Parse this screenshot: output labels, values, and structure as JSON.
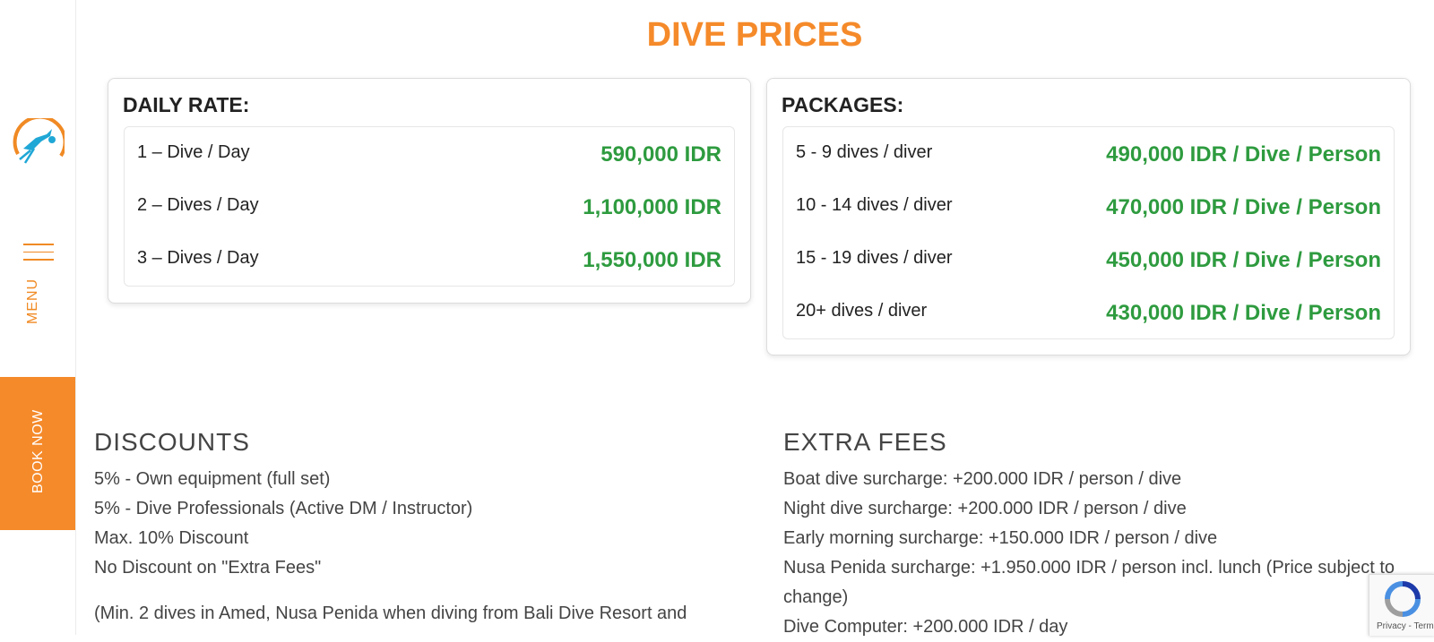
{
  "sidebar": {
    "menu_label": "MENU",
    "book_now_label": "BOOK NOW"
  },
  "page_title": "DIVE PRICES",
  "daily_rate": {
    "heading": "DAILY RATE:",
    "rows": [
      {
        "label": "1 – Dive / Day",
        "price": "590,000 IDR"
      },
      {
        "label": "2 – Dives / Day",
        "price": "1,100,000 IDR"
      },
      {
        "label": "3 – Dives / Day",
        "price": "1,550,000 IDR"
      }
    ]
  },
  "packages": {
    "heading": "PACKAGES:",
    "rows": [
      {
        "label": "5 - 9 dives / diver",
        "price": "490,000 IDR / Dive / Person"
      },
      {
        "label": "10 - 14 dives / diver",
        "price": "470,000 IDR / Dive / Person"
      },
      {
        "label": "15 - 19 dives / diver",
        "price": "450,000 IDR / Dive / Person"
      },
      {
        "label": "20+ dives / diver",
        "price": "430,000 IDR / Dive / Person"
      }
    ]
  },
  "discounts": {
    "heading": "DISCOUNTS",
    "items": [
      "5% - Own equipment (full set)",
      "5% - Dive Professionals (Active DM / Instructor)",
      "Max. 10% Discount",
      "No Discount on \"Extra Fees\""
    ],
    "note": "(Min. 2 dives in Amed, Nusa Penida when diving from Bali Dive Resort and"
  },
  "extra_fees": {
    "heading": "EXTRA FEES",
    "items": [
      "Boat dive surcharge: +200.000 IDR / person / dive",
      "Night dive surcharge: +200.000 IDR / person / dive",
      "Early morning surcharge: +150.000 IDR / person / dive",
      "Nusa Penida surcharge: +1.950.000 IDR / person incl. lunch (Price subject to change)",
      "Dive Computer: +200.000 IDR / day"
    ]
  },
  "recaptcha": {
    "links": "Privacy - Terms"
  },
  "colors": {
    "accent": "#f58a2a",
    "price_green": "#2e9b3f",
    "logo_diver": "#1fa7d6"
  }
}
